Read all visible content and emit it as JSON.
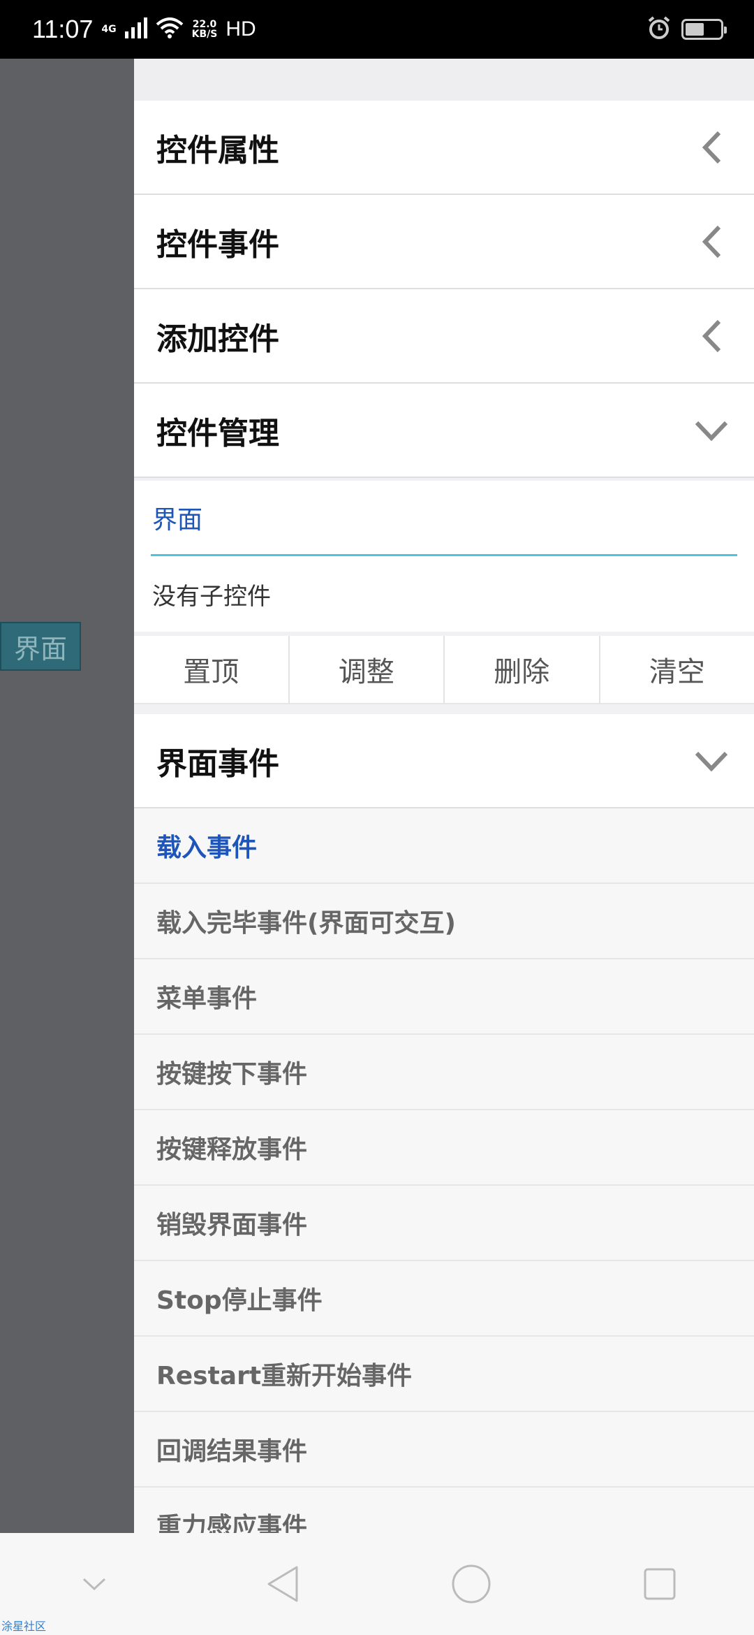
{
  "status_bar": {
    "time": "11:07",
    "network": "4G",
    "speed_top": "22.0",
    "speed_bottom": "KB/S",
    "hd": "HD"
  },
  "canvas": {
    "selected_label": "界面"
  },
  "drawer": {
    "sections": [
      {
        "title": "控件属性",
        "state": "collapsed"
      },
      {
        "title": "控件事件",
        "state": "collapsed"
      },
      {
        "title": "添加控件",
        "state": "collapsed"
      },
      {
        "title": "控件管理",
        "state": "expanded"
      }
    ],
    "management": {
      "tab_label": "界面",
      "empty_text": "没有子控件",
      "buttons": [
        "置顶",
        "调整",
        "删除",
        "清空"
      ]
    },
    "events_section": {
      "title": "界面事件",
      "state": "expanded"
    },
    "events": [
      "载入事件",
      "载入完毕事件(界面可交互)",
      "菜单事件",
      "按键按下事件",
      "按键释放事件",
      "销毁界面事件",
      "Stop停止事件",
      "Restart重新开始事件",
      "回调结果事件",
      "重力感应事件"
    ],
    "active_event_index": 0
  },
  "nav_bar": {
    "items": [
      "collapse-chevron-icon",
      "back-triangle-icon",
      "home-circle-icon",
      "recents-square-icon"
    ]
  },
  "watermark": "涂星社区",
  "colors": {
    "accent_blue": "#1e55b9",
    "underline_cyan": "#50c4dc",
    "overlay_gray": "#5f6063"
  }
}
